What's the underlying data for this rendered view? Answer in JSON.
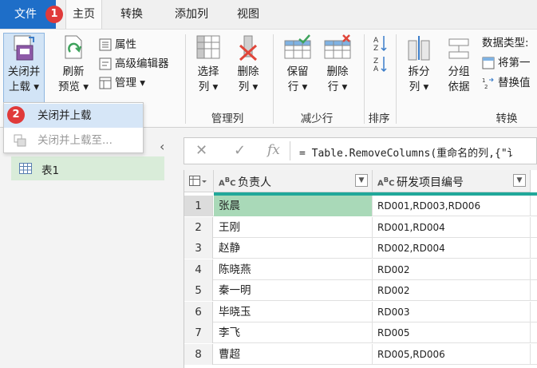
{
  "tabs": {
    "file": "文件",
    "home": "主页",
    "transform": "转换",
    "add_column": "添加列",
    "view": "视图"
  },
  "badges": {
    "first": "1",
    "second": "2"
  },
  "ribbon": {
    "close_load_line1": "关闭并",
    "close_load_line2": "上载",
    "refresh_line1": "刷新",
    "refresh_line2": "预览",
    "properties": "属性",
    "advanced_editor": "高级编辑器",
    "manage": "管理",
    "choose_line1": "选择",
    "choose_line2": "列",
    "remove_line1": "删除",
    "remove_line2": "列",
    "keep_line1": "保留",
    "keep_line2": "行",
    "remove_rows_line1": "删除",
    "remove_rows_line2": "行",
    "split_line1": "拆分",
    "split_line2": "列",
    "group_line1": "分组",
    "group_line2": "依据",
    "data_type": "数据类型:",
    "use_first_row": "将第一",
    "replace_values": "替换值",
    "groups": {
      "manage_columns": "管理列",
      "reduce_rows": "减少行",
      "sort": "排序",
      "transform": "转换"
    }
  },
  "menu": {
    "close_and_load": "关闭并上载",
    "close_and_load_to": "关闭并上载至..."
  },
  "queries": {
    "item1": "表1"
  },
  "formula": "= Table.RemoveColumns(重命名的列,{\"讠",
  "columns": {
    "col1": "负责人",
    "col2": "研发项目编号"
  },
  "rows": [
    {
      "n": "1",
      "name": "张晨",
      "code": "RD001,RD003,RD006"
    },
    {
      "n": "2",
      "name": "王刚",
      "code": "RD001,RD004"
    },
    {
      "n": "3",
      "name": "赵静",
      "code": "RD002,RD004"
    },
    {
      "n": "4",
      "name": "陈晓燕",
      "code": "RD002"
    },
    {
      "n": "5",
      "name": "秦一明",
      "code": "RD002"
    },
    {
      "n": "6",
      "name": "毕晓玉",
      "code": "RD003"
    },
    {
      "n": "7",
      "name": "李飞",
      "code": "RD005"
    },
    {
      "n": "8",
      "name": "曹超",
      "code": "RD005,RD006"
    }
  ],
  "colors": {
    "file_tab": "#1e6ec8",
    "badge": "#e03a3a",
    "teal": "#21a89a",
    "selected_row": "#a9d9b8"
  }
}
